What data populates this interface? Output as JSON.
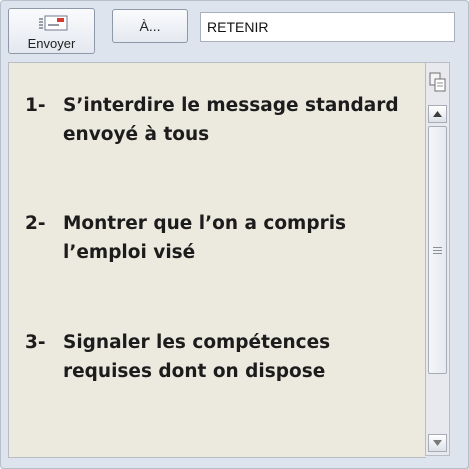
{
  "toolbar": {
    "send_label": "Envoyer",
    "to_label": "À...",
    "subject_value": "RETENIR"
  },
  "content": {
    "items": [
      {
        "number": "1-",
        "line1": "S’interdire le message standard",
        "line2": "envoyé à tous"
      },
      {
        "number": "2-",
        "line1": "Montrer que l’on a compris",
        "line2": "l’emploi visé"
      },
      {
        "number": "3-",
        "line1": "Signaler les compétences",
        "line2": "requises dont on dispose"
      }
    ]
  },
  "icons": {
    "send": "send-envelope-icon",
    "corner": "page-split-icon",
    "up": "arrow-up-icon",
    "down": "arrow-down-icon",
    "grip": "scroll-grip-icon"
  }
}
